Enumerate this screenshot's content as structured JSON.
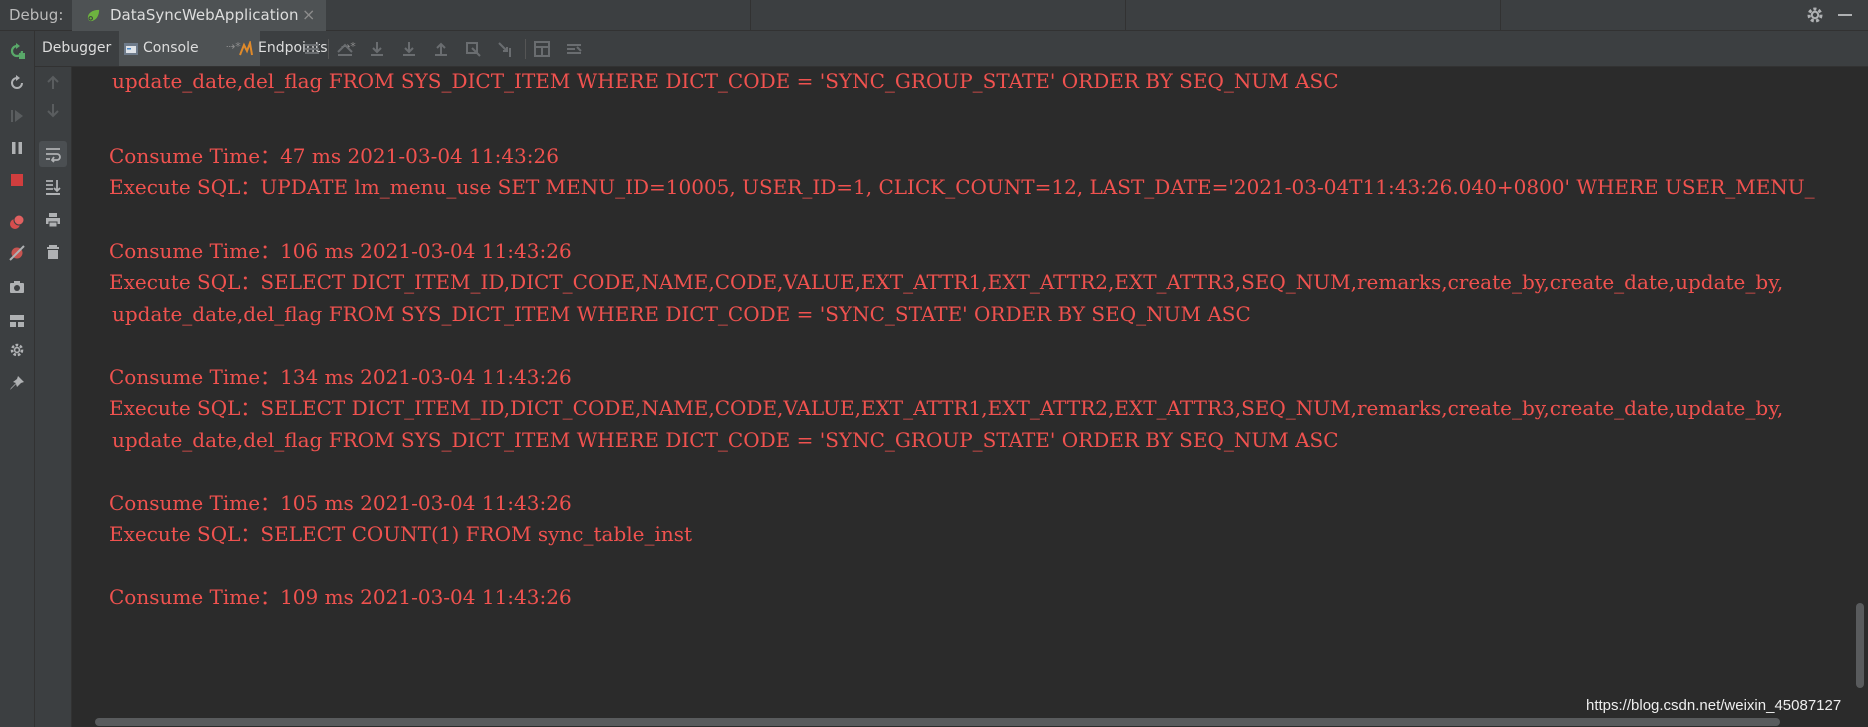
{
  "topbar": {
    "debug_label": "Debug:",
    "run_tab_label": "DataSyncWebApplication",
    "close_glyph": "×"
  },
  "toolbar": {
    "debugger_label": "Debugger",
    "console_label": "Console",
    "endpoints_label": "Endpoints",
    "pin_glyph": "⇢*"
  },
  "console": {
    "lines": [
      "update_date,del_flag FROM SYS_DICT_ITEM WHERE DICT_CODE = 'SYNC_GROUP_STATE' ORDER BY SEQ_NUM ASC",
      "Consume Time：47 ms 2021-03-04 11:43:26",
      "Execute SQL：UPDATE lm_menu_use SET MENU_ID=10005, USER_ID=1, CLICK_COUNT=12, LAST_DATE='2021-03-04T11:43:26.040+0800' WHERE USER_MENU_",
      "Consume Time：106 ms 2021-03-04 11:43:26",
      "Execute SQL：SELECT DICT_ITEM_ID,DICT_CODE,NAME,CODE,VALUE,EXT_ATTR1,EXT_ATTR2,EXT_ATTR3,SEQ_NUM,remarks,create_by,create_date,update_by,",
      "update_date,del_flag FROM SYS_DICT_ITEM WHERE DICT_CODE = 'SYNC_STATE' ORDER BY SEQ_NUM ASC",
      "Consume Time：134 ms 2021-03-04 11:43:26",
      "Execute SQL：SELECT DICT_ITEM_ID,DICT_CODE,NAME,CODE,VALUE,EXT_ATTR1,EXT_ATTR2,EXT_ATTR3,SEQ_NUM,remarks,create_by,create_date,update_by,",
      "update_date,del_flag FROM SYS_DICT_ITEM WHERE DICT_CODE = 'SYNC_GROUP_STATE' ORDER BY SEQ_NUM ASC",
      "Consume Time：105 ms 2021-03-04 11:43:26",
      "Execute SQL：SELECT COUNT(1) FROM sync_table_inst",
      "Consume Time：109 ms 2021-03-04 11:43:26"
    ]
  },
  "watermark": "https://blog.csdn.net/weixin_45087127",
  "colors": {
    "console_text": "#f0524f",
    "background": "#2b2b2b",
    "panel": "#3c3f41"
  }
}
